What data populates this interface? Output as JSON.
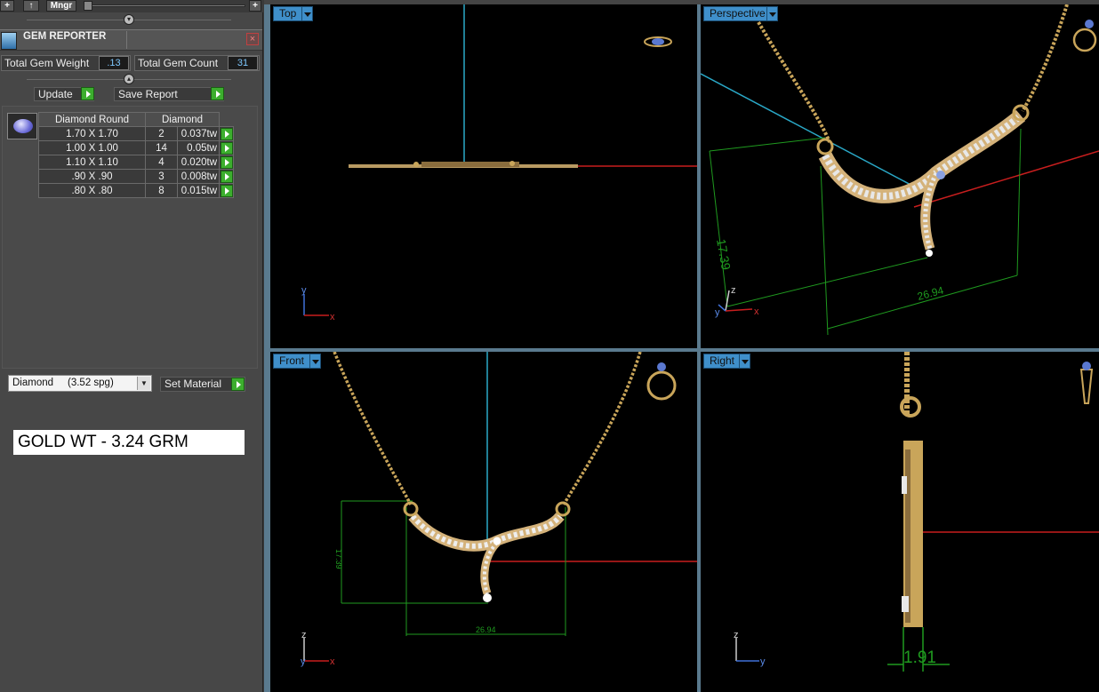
{
  "toolbar": {
    "plus_left": "+",
    "up_arrow": "↑",
    "mngr_label": "Mngr",
    "plus_right": "+"
  },
  "gem_reporter": {
    "title": "GEM REPORTER",
    "close": "×",
    "total_weight_label": "Total Gem Weight",
    "total_weight_value": ".13",
    "total_count_label": "Total Gem Count",
    "total_count_value": "31",
    "update_label": "Update",
    "save_report_label": "Save Report",
    "table": {
      "headers": [
        "Diamond Round",
        "Diamond"
      ],
      "rows": [
        {
          "size": "1.70 X 1.70",
          "count": "2",
          "weight": "0.037tw"
        },
        {
          "size": "1.00 X 1.00",
          "count": "14",
          "weight": "0.05tw"
        },
        {
          "size": "1.10 X 1.10",
          "count": "4",
          "weight": "0.020tw"
        },
        {
          "size": ".90 X .90",
          "count": "3",
          "weight": "0.008tw"
        },
        {
          "size": ".80 X .80",
          "count": "8",
          "weight": "0.015tw"
        }
      ]
    },
    "material_value": "Diamond     (3.52 spg)",
    "set_material_label": "Set Material",
    "gold_weight_text": "GOLD WT - 3.24 GRM"
  },
  "viewports": {
    "top": {
      "label": "Top"
    },
    "perspective": {
      "label": "Perspective"
    },
    "front": {
      "label": "Front"
    },
    "right": {
      "label": "Right"
    }
  },
  "dimensions": {
    "height_17_39": "17.39",
    "width_26_94": "26.94",
    "depth_1_91": "1.91"
  },
  "axes": {
    "x": "x",
    "y": "y",
    "z": "z"
  },
  "colors": {
    "viewport_tab": "#3f8fca",
    "go_button": "#3cae2e",
    "dimension_green": "#1f9a1f",
    "axis_red": "#c81e1e",
    "axis_cyan": "#2aa9c8",
    "gold": "#c9a55a"
  }
}
